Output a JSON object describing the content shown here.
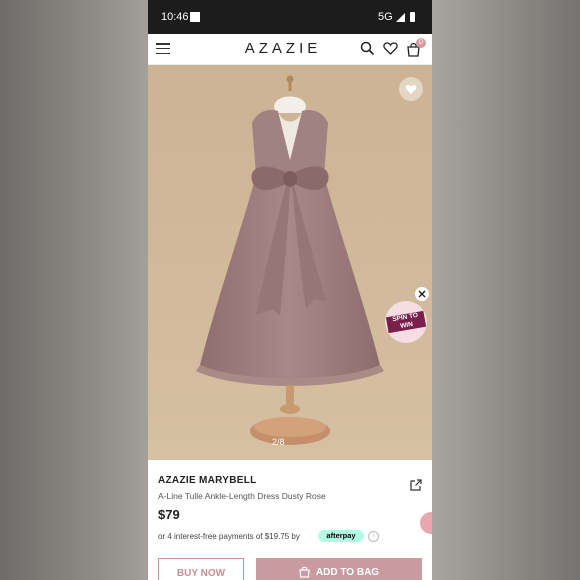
{
  "status_bar": {
    "time": "10:46",
    "network": "5G"
  },
  "header": {
    "brand": "AZAZIE",
    "bag_count": "0"
  },
  "product_image": {
    "counter": "2/8",
    "spin_badge": "SPIN TO WIN"
  },
  "product": {
    "brand": "AZAZIE MARYBELL",
    "name": "A-Line Tulle Ankle-Length Dress Dusty Rose",
    "price": "$79",
    "installments": "or 4 interest-free payments of $19.75 by",
    "afterpay": "afterpay",
    "info_icon": "i"
  },
  "actions": {
    "buy_now": "BUY NOW",
    "add_to_bag": "ADD TO BAG"
  },
  "colors": {
    "accent": "#c99aa0",
    "dress": "#a48283",
    "backdrop": "#cfb89a"
  }
}
